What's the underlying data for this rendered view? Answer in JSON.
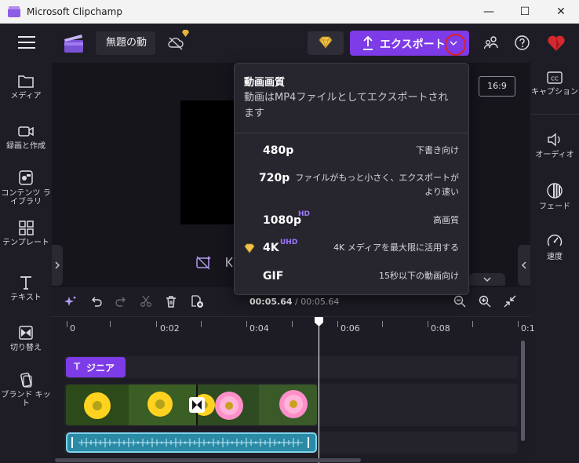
{
  "window": {
    "title": "Microsoft Clipchamp",
    "minimize": "—",
    "maximize": "☐",
    "close": "✕"
  },
  "header": {
    "project_name": "無題の動",
    "export_label": "エクスポート"
  },
  "left_rail": {
    "items": [
      {
        "label": "メディア"
      },
      {
        "label": "録画と作成"
      },
      {
        "label": "コンテンツ ライブラリ"
      },
      {
        "label": "テンプレート"
      },
      {
        "label": "テキスト"
      },
      {
        "label": "切り替え"
      },
      {
        "label": "ブランド キット"
      }
    ]
  },
  "right_rail": {
    "items": [
      {
        "label": "キャプション"
      },
      {
        "label": "オーディオ"
      },
      {
        "label": "フェード"
      },
      {
        "label": "速度"
      }
    ]
  },
  "stage": {
    "aspect_ratio": "16:9"
  },
  "export_menu": {
    "heading": "動画画質",
    "subtitle": "動画はMP4ファイルとしてエクスポートされます",
    "options": [
      {
        "res": "480p",
        "badge": "",
        "desc": "下書き向け"
      },
      {
        "res": "720p",
        "badge": "",
        "desc": "ファイルがもっと小さく、エクスポートがより速い"
      },
      {
        "res": "1080p",
        "badge": "HD",
        "desc": "高画質"
      },
      {
        "res": "4K",
        "badge": "UHD",
        "desc": "4K メディアを最大限に活用する"
      },
      {
        "res": "GIF",
        "badge": "",
        "desc": "15秒以下の動画向け"
      }
    ]
  },
  "timeline": {
    "current_time": "00:05.64",
    "separator": " / ",
    "total_time": "00:05.64",
    "ruler": [
      "0",
      "0:02",
      "0:04",
      "0:06",
      "0:08",
      "0:1"
    ],
    "text_clip_label": "ジニア",
    "text_clip_icon": "T"
  },
  "colors": {
    "accent": "#7e3ce8",
    "badge": "#9b78ff",
    "audio": "#2b8aa6",
    "highlight_circle": "#e0201e"
  }
}
